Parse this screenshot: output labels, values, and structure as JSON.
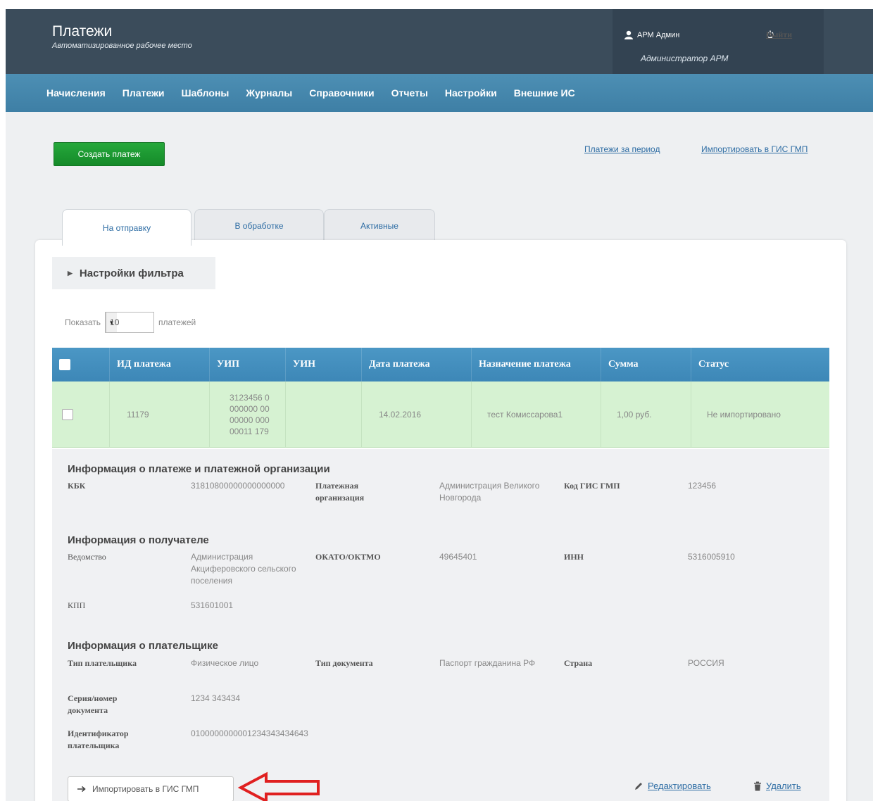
{
  "header": {
    "title": "Платежи",
    "subtitle": "Автоматизированное рабочее место",
    "user_name": "АРМ Админ",
    "user_role": "Администратор АРМ",
    "logout_label": "Выйти"
  },
  "nav": [
    "Начисления",
    "Платежи",
    "Шаблоны",
    "Журналы",
    "Справочники",
    "Отчеты",
    "Настройки",
    "Внешние ИС"
  ],
  "actions": {
    "create_label": "Создать платеж",
    "period_link": "Платежи за период",
    "import_link": "Импортировать в ГИС ГМП"
  },
  "tabs": [
    "На отправку",
    "В обработке",
    "Активные"
  ],
  "filter": {
    "label": "Настройки фильтра"
  },
  "paging": {
    "show_label": "Показать",
    "page_size": "10",
    "suffix": "платежей"
  },
  "table": {
    "headers": [
      "ИД платежа",
      "УИП",
      "УИН",
      "Дата платежа",
      "Назначение платежа",
      "Сумма",
      "Статус"
    ],
    "row": {
      "id": "11179",
      "uip": "3123456 0000000 0000000 00000011 179",
      "uin": "",
      "date": "14.02.2016",
      "purpose": "тест Комиссарова1",
      "sum": "1,00 руб.",
      "status": "Не импортировано"
    }
  },
  "details": {
    "section1": {
      "title": "Информация о платеже и платежной организации",
      "kbk_label": "КБК",
      "kbk_value": "31810800000000000000",
      "org_label": "Платежная организация",
      "org_value": "Администрация Великого Новгорода",
      "gis_code_label": "Код ГИС ГМП",
      "gis_code_value": "123456"
    },
    "section2": {
      "title": "Информация о получателе",
      "dept_label": "Ведомство",
      "dept_value": "Администрация Акциферовского сельского поселения",
      "okato_label": "ОКАТО/ОКТМО",
      "okato_value": "49645401",
      "inn_label": "ИНН",
      "inn_value": "5316005910",
      "kpp_label": "КПП",
      "kpp_value": "531601001"
    },
    "section3": {
      "title": "Информация о плательщике",
      "payer_type_label": "Тип плательщика",
      "payer_type_value": "Физическое лицо",
      "doc_type_label": "Тип документа",
      "doc_type_value": "Паспорт гражданина РФ",
      "country_label": "Страна",
      "country_value": "РОССИЯ",
      "doc_num_label": "Серия/номер документа",
      "doc_num_value": "1234 343434",
      "payer_id_label": "Идентификатор плательщика",
      "payer_id_value": "0100000000001234343434643"
    },
    "buttons": {
      "import_label": "Импортировать в ГИС ГМП",
      "edit_label": "Редактировать",
      "delete_label": "Удалить"
    }
  },
  "colors": {
    "header_bg": "#3b4c5b",
    "nav_bg": "#4389b0",
    "create_btn": "#1f9a34",
    "row_bg": "#d6f2d2",
    "table_header": "#4490c0",
    "arrow": "#e02020"
  }
}
